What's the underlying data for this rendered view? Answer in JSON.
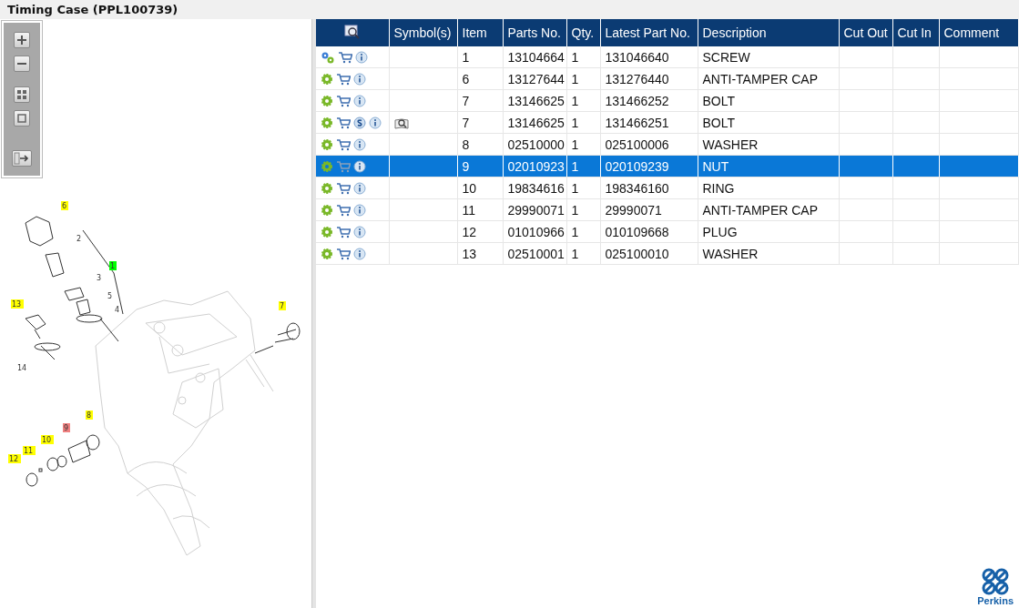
{
  "window": {
    "title": "Timing Case (PPL100739)"
  },
  "viewer_toolbar": [
    {
      "kind": "zoom-in"
    },
    {
      "kind": "zoom-out"
    },
    {
      "kind": "grid"
    },
    {
      "kind": "fit"
    },
    {
      "kind": "export"
    }
  ],
  "callouts": [
    {
      "label": "6",
      "kind": "highlighted",
      "color": "#ffff00"
    },
    {
      "label": "2",
      "kind": "plain"
    },
    {
      "label": "1",
      "kind": "highlighted",
      "color": "#00ff00"
    },
    {
      "label": "3",
      "kind": "plain"
    },
    {
      "label": "5",
      "kind": "plain"
    },
    {
      "label": "4",
      "kind": "plain"
    },
    {
      "label": "13",
      "kind": "highlighted",
      "color": "#ffff00"
    },
    {
      "label": "14",
      "kind": "plain"
    },
    {
      "label": "7",
      "kind": "highlighted",
      "color": "#ffff00"
    },
    {
      "label": "8",
      "kind": "highlighted",
      "color": "#ffff00"
    },
    {
      "label": "9",
      "kind": "highlighted",
      "color": "#f08080"
    },
    {
      "label": "10",
      "kind": "highlighted",
      "color": "#ffff00"
    },
    {
      "label": "11",
      "kind": "highlighted",
      "color": "#ffff00"
    },
    {
      "label": "12",
      "kind": "highlighted",
      "color": "#ffff00"
    }
  ],
  "table": {
    "columns": [
      "Symbol(s)",
      "Item",
      "Parts No.",
      "Qty.",
      "Latest Part No.",
      "Description",
      "Cut Out",
      "Cut In",
      "Comment"
    ],
    "rows": [
      {
        "selected": false,
        "icons": [
          {
            "kind": "gears"
          },
          {
            "kind": "cart"
          },
          {
            "kind": "info"
          }
        ],
        "symbol": false,
        "item": "1",
        "parts_no": "13104664",
        "qty": "1",
        "latest_part_no": "131046640",
        "description": "SCREW"
      },
      {
        "selected": false,
        "icons": [
          {
            "kind": "gear"
          },
          {
            "kind": "cart"
          },
          {
            "kind": "info"
          }
        ],
        "symbol": false,
        "item": "6",
        "parts_no": "13127644",
        "qty": "1",
        "latest_part_no": "131276440",
        "description": "ANTI-TAMPER CAP"
      },
      {
        "selected": false,
        "icons": [
          {
            "kind": "gear"
          },
          {
            "kind": "cart"
          },
          {
            "kind": "info"
          }
        ],
        "symbol": false,
        "item": "7",
        "parts_no": "13146625",
        "qty": "1",
        "latest_part_no": "131466252",
        "description": "BOLT"
      },
      {
        "selected": false,
        "icons": [
          {
            "kind": "gear"
          },
          {
            "kind": "cart"
          },
          {
            "kind": "s"
          },
          {
            "kind": "info"
          }
        ],
        "symbol": true,
        "item": "7",
        "parts_no": "13146625",
        "qty": "1",
        "latest_part_no": "131466251",
        "description": "BOLT"
      },
      {
        "selected": false,
        "icons": [
          {
            "kind": "gear"
          },
          {
            "kind": "cart"
          },
          {
            "kind": "info"
          }
        ],
        "symbol": false,
        "item": "8",
        "parts_no": "02510000",
        "qty": "1",
        "latest_part_no": "025100006",
        "description": "WASHER"
      },
      {
        "selected": true,
        "icons": [
          {
            "kind": "gear"
          },
          {
            "kind": "cart"
          },
          {
            "kind": "info"
          }
        ],
        "symbol": false,
        "item": "9",
        "parts_no": "02010923",
        "qty": "1",
        "latest_part_no": "020109239",
        "description": "NUT"
      },
      {
        "selected": false,
        "icons": [
          {
            "kind": "gear"
          },
          {
            "kind": "cart"
          },
          {
            "kind": "info"
          }
        ],
        "symbol": false,
        "item": "10",
        "parts_no": "19834616",
        "qty": "1",
        "latest_part_no": "198346160",
        "description": "RING"
      },
      {
        "selected": false,
        "icons": [
          {
            "kind": "gear"
          },
          {
            "kind": "cart"
          },
          {
            "kind": "info"
          }
        ],
        "symbol": false,
        "item": "11",
        "parts_no": "29990071",
        "qty": "1",
        "latest_part_no": "29990071",
        "description": "ANTI-TAMPER CAP"
      },
      {
        "selected": false,
        "icons": [
          {
            "kind": "gear"
          },
          {
            "kind": "cart"
          },
          {
            "kind": "info"
          }
        ],
        "symbol": false,
        "item": "12",
        "parts_no": "01010966",
        "qty": "1",
        "latest_part_no": "010109668",
        "description": "PLUG"
      },
      {
        "selected": false,
        "icons": [
          {
            "kind": "gear"
          },
          {
            "kind": "cart"
          },
          {
            "kind": "info"
          }
        ],
        "symbol": false,
        "item": "13",
        "parts_no": "02510001",
        "qty": "1",
        "latest_part_no": "025100010",
        "description": "WASHER"
      }
    ]
  },
  "logo": {
    "text": "Perkins"
  }
}
